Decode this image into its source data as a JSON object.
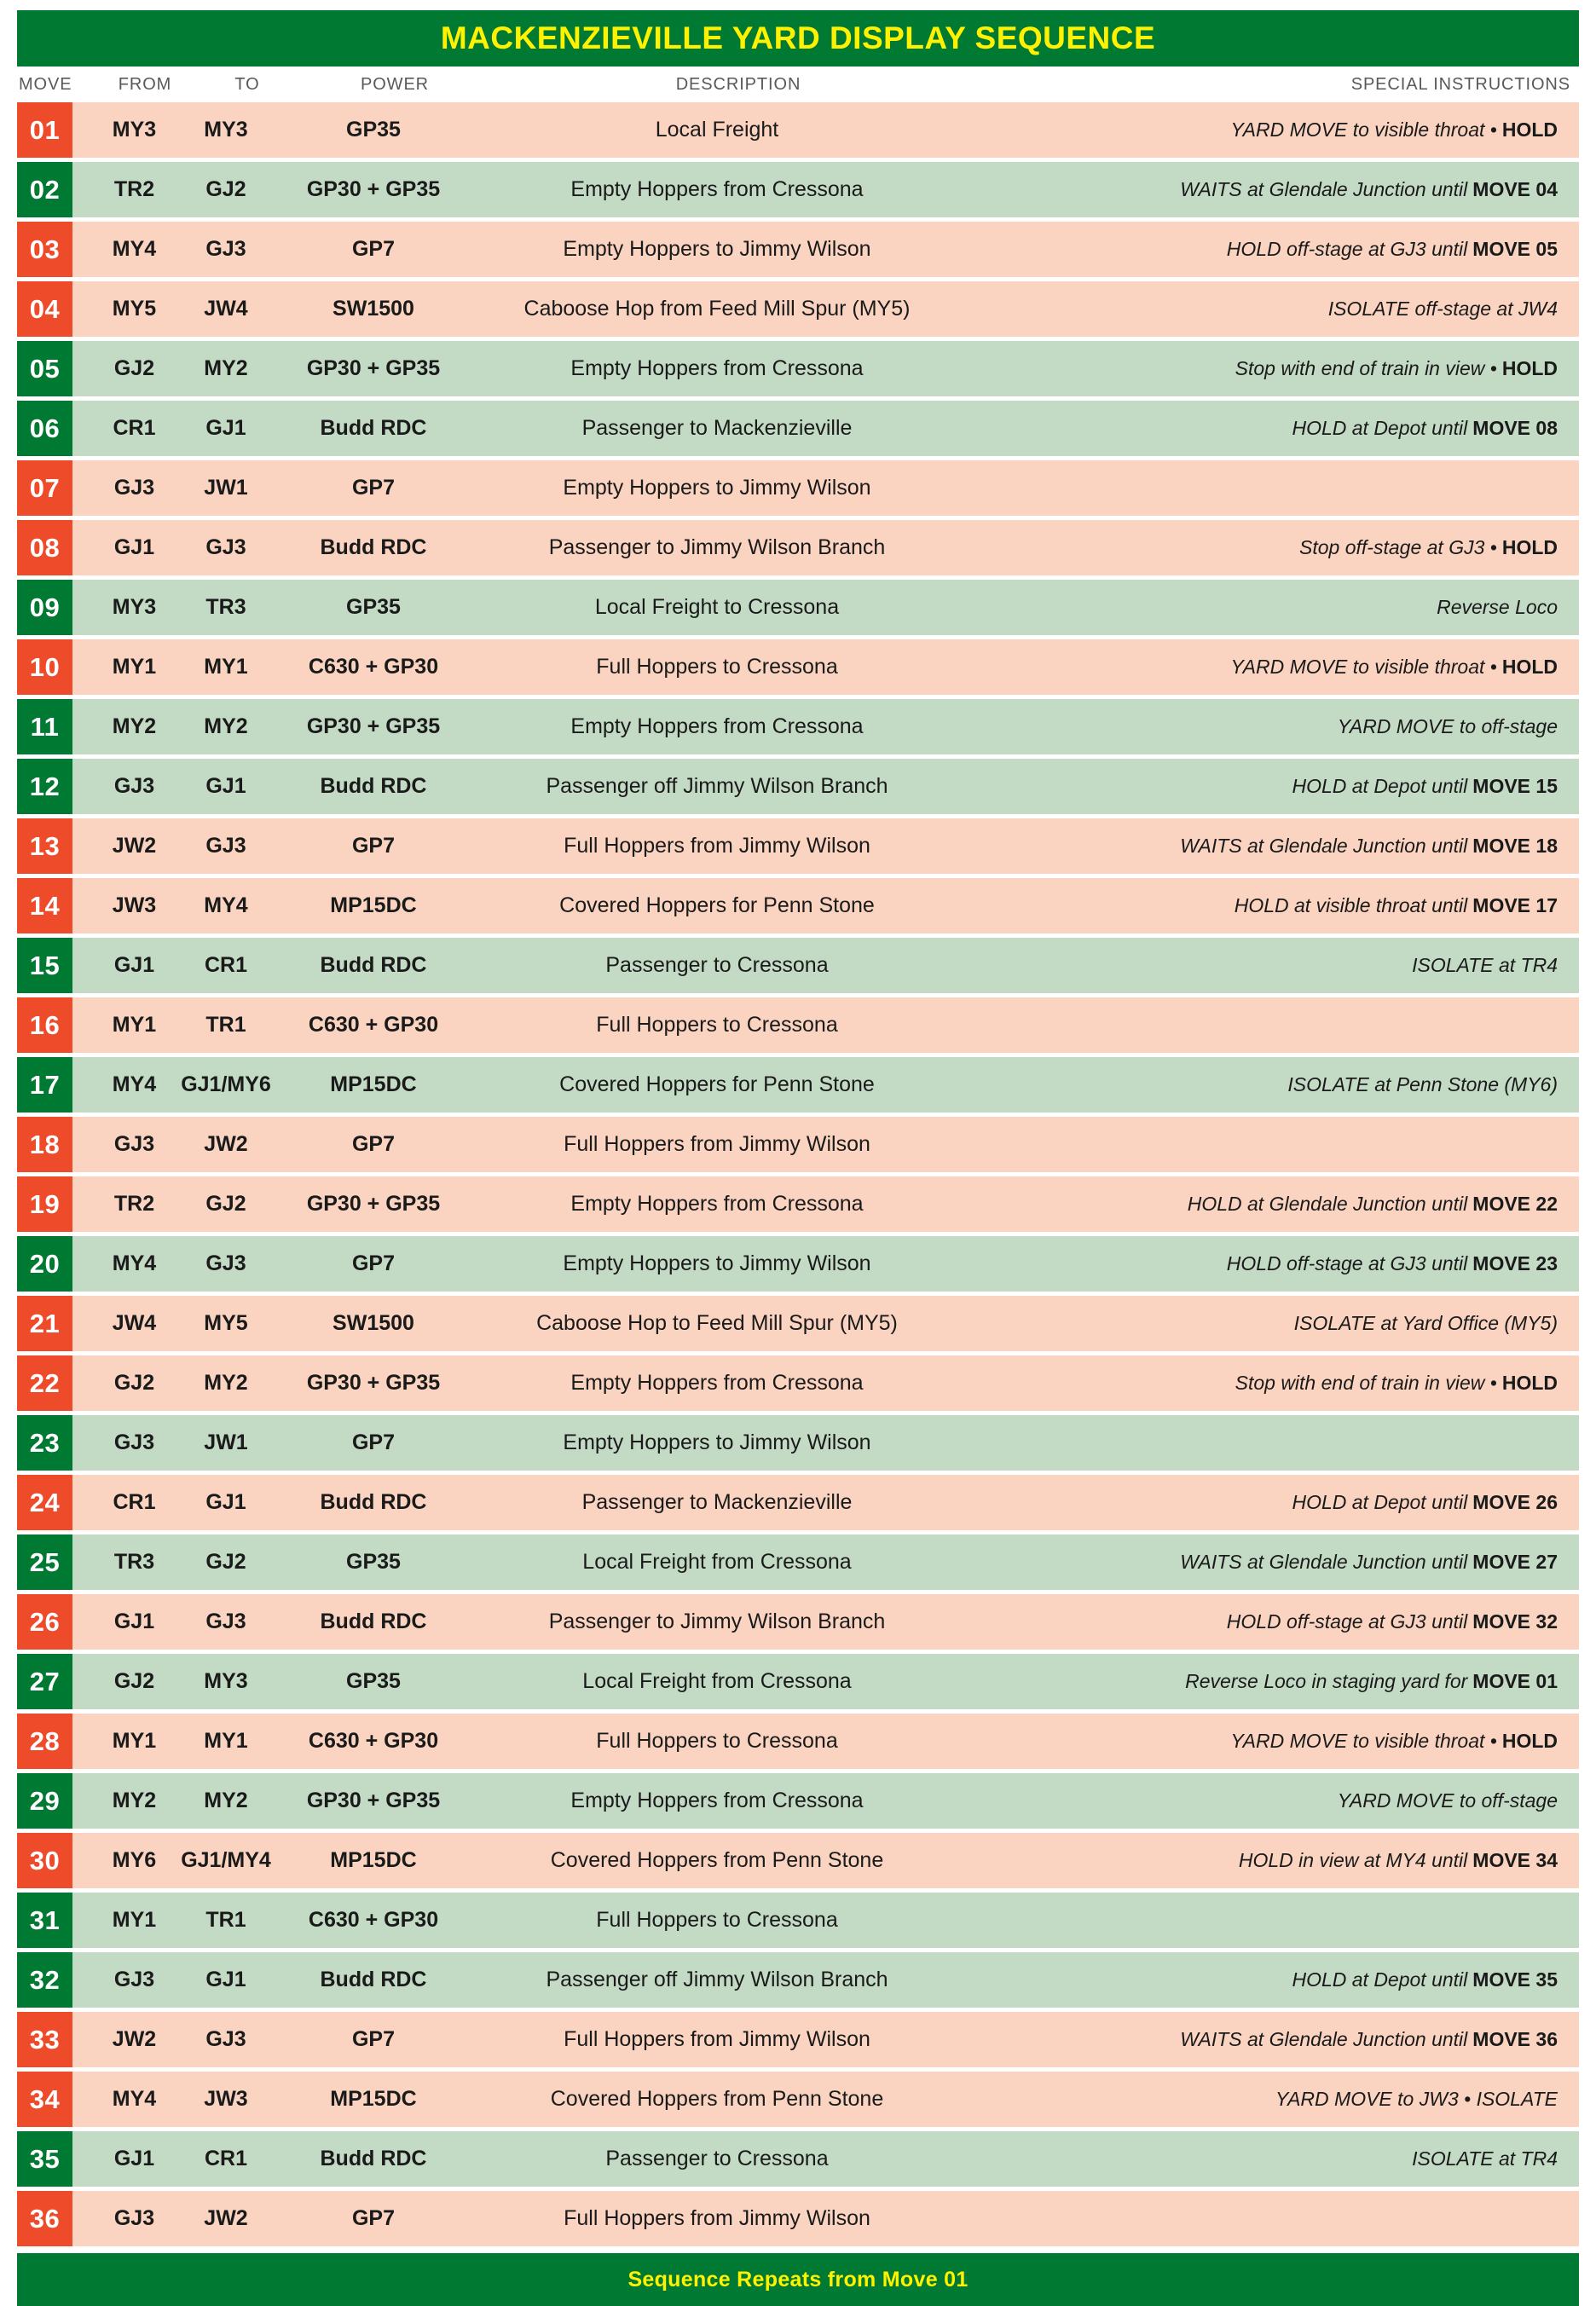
{
  "title": "MACKENZIEVILLE YARD DISPLAY SEQUENCE",
  "colors": {
    "header_green": "#007A33",
    "header_yellow": "#FFF200",
    "badge_red": "#EE4B2B",
    "badge_green": "#007A33",
    "row_pink": "#FAD4C0",
    "row_green": "#C3DBC5"
  },
  "columns": {
    "move": "MOVE",
    "from": "FROM",
    "to": "TO",
    "power": "POWER",
    "description": "DESCRIPTION",
    "instructions": "SPECIAL INSTRUCTIONS"
  },
  "footer": "Sequence Repeats from Move 01",
  "rows": [
    {
      "move": "01",
      "from": "MY3",
      "to": "MY3",
      "power": "GP35",
      "desc": "Local Freight",
      "inst": "YARD MOVE to visible throat • ",
      "inst_bold": "HOLD",
      "badge": "red",
      "bg": "pink"
    },
    {
      "move": "02",
      "from": "TR2",
      "to": "GJ2",
      "power": "GP30 + GP35",
      "desc": "Empty Hoppers from Cressona",
      "inst": "WAITS at Glendale Junction until ",
      "inst_bold": "MOVE 04",
      "badge": "green",
      "bg": "green"
    },
    {
      "move": "03",
      "from": "MY4",
      "to": "GJ3",
      "power": "GP7",
      "desc": "Empty Hoppers to Jimmy Wilson",
      "inst": "HOLD off-stage at GJ3 until ",
      "inst_bold": "MOVE 05",
      "badge": "red",
      "bg": "pink"
    },
    {
      "move": "04",
      "from": "MY5",
      "to": "JW4",
      "power": "SW1500",
      "desc": "Caboose Hop from Feed Mill Spur (MY5)",
      "inst": "ISOLATE off-stage at JW4",
      "inst_bold": "",
      "badge": "red",
      "bg": "pink"
    },
    {
      "move": "05",
      "from": "GJ2",
      "to": "MY2",
      "power": "GP30 + GP35",
      "desc": "Empty Hoppers from Cressona",
      "inst": "Stop with end of train in view • ",
      "inst_bold": "HOLD",
      "badge": "green",
      "bg": "green"
    },
    {
      "move": "06",
      "from": "CR1",
      "to": "GJ1",
      "power": "Budd RDC",
      "desc": "Passenger to Mackenzieville",
      "inst": "HOLD at Depot until ",
      "inst_bold": "MOVE 08",
      "badge": "green",
      "bg": "green"
    },
    {
      "move": "07",
      "from": "GJ3",
      "to": "JW1",
      "power": "GP7",
      "desc": "Empty Hoppers to Jimmy Wilson",
      "inst": "",
      "inst_bold": "",
      "badge": "red",
      "bg": "pink"
    },
    {
      "move": "08",
      "from": "GJ1",
      "to": "GJ3",
      "power": "Budd RDC",
      "desc": "Passenger to Jimmy Wilson Branch",
      "inst": "Stop off-stage at GJ3 • ",
      "inst_bold": "HOLD",
      "badge": "red",
      "bg": "pink"
    },
    {
      "move": "09",
      "from": "MY3",
      "to": "TR3",
      "power": "GP35",
      "desc": "Local Freight to Cressona",
      "inst": "Reverse Loco",
      "inst_bold": "",
      "badge": "green",
      "bg": "green"
    },
    {
      "move": "10",
      "from": "MY1",
      "to": "MY1",
      "power": "C630 + GP30",
      "desc": "Full Hoppers to Cressona",
      "inst": "YARD MOVE to visible throat • ",
      "inst_bold": "HOLD",
      "badge": "red",
      "bg": "pink"
    },
    {
      "move": "11",
      "from": "MY2",
      "to": "MY2",
      "power": "GP30 + GP35",
      "desc": "Empty Hoppers from Cressona",
      "inst": "YARD MOVE to off-stage",
      "inst_bold": "",
      "badge": "green",
      "bg": "green"
    },
    {
      "move": "12",
      "from": "GJ3",
      "to": "GJ1",
      "power": "Budd RDC",
      "desc": "Passenger off Jimmy Wilson Branch",
      "inst": "HOLD at Depot until ",
      "inst_bold": "MOVE 15",
      "badge": "green",
      "bg": "green"
    },
    {
      "move": "13",
      "from": "JW2",
      "to": "GJ3",
      "power": "GP7",
      "desc": "Full Hoppers from Jimmy Wilson",
      "inst": "WAITS at Glendale Junction until ",
      "inst_bold": "MOVE 18",
      "badge": "red",
      "bg": "pink"
    },
    {
      "move": "14",
      "from": "JW3",
      "to": "MY4",
      "power": "MP15DC",
      "desc": "Covered Hoppers for Penn Stone",
      "inst": "HOLD at visible throat until ",
      "inst_bold": "MOVE 17",
      "badge": "red",
      "bg": "pink"
    },
    {
      "move": "15",
      "from": "GJ1",
      "to": "CR1",
      "power": "Budd RDC",
      "desc": "Passenger to Cressona",
      "inst": "ISOLATE at TR4",
      "inst_bold": "",
      "badge": "green",
      "bg": "green"
    },
    {
      "move": "16",
      "from": "MY1",
      "to": "TR1",
      "power": "C630 + GP30",
      "desc": "Full Hoppers to Cressona",
      "inst": "",
      "inst_bold": "",
      "badge": "red",
      "bg": "pink"
    },
    {
      "move": "17",
      "from": "MY4",
      "to": "GJ1/MY6",
      "power": "MP15DC",
      "desc": "Covered Hoppers for Penn Stone",
      "inst": "ISOLATE at Penn Stone (MY6)",
      "inst_bold": "",
      "badge": "green",
      "bg": "green"
    },
    {
      "move": "18",
      "from": "GJ3",
      "to": "JW2",
      "power": "GP7",
      "desc": "Full Hoppers from Jimmy Wilson",
      "inst": "",
      "inst_bold": "",
      "badge": "red",
      "bg": "pink"
    },
    {
      "move": "19",
      "from": "TR2",
      "to": "GJ2",
      "power": "GP30 + GP35",
      "desc": "Empty Hoppers from Cressona",
      "inst": "HOLD at Glendale Junction until ",
      "inst_bold": "MOVE 22",
      "badge": "red",
      "bg": "pink"
    },
    {
      "move": "20",
      "from": "MY4",
      "to": "GJ3",
      "power": "GP7",
      "desc": "Empty Hoppers to Jimmy Wilson",
      "inst": "HOLD off-stage at GJ3 until ",
      "inst_bold": "MOVE 23",
      "badge": "green",
      "bg": "green"
    },
    {
      "move": "21",
      "from": "JW4",
      "to": "MY5",
      "power": "SW1500",
      "desc": "Caboose Hop to Feed Mill Spur (MY5)",
      "inst": "ISOLATE at Yard Office (MY5)",
      "inst_bold": "",
      "badge": "red",
      "bg": "pink"
    },
    {
      "move": "22",
      "from": "GJ2",
      "to": "MY2",
      "power": "GP30 + GP35",
      "desc": "Empty Hoppers from Cressona",
      "inst": "Stop with end of train in view • ",
      "inst_bold": "HOLD",
      "badge": "red",
      "bg": "pink"
    },
    {
      "move": "23",
      "from": "GJ3",
      "to": "JW1",
      "power": "GP7",
      "desc": "Empty Hoppers to Jimmy Wilson",
      "inst": "",
      "inst_bold": "",
      "badge": "green",
      "bg": "green"
    },
    {
      "move": "24",
      "from": "CR1",
      "to": "GJ1",
      "power": "Budd RDC",
      "desc": "Passenger to Mackenzieville",
      "inst": "HOLD at Depot until ",
      "inst_bold": "MOVE 26",
      "badge": "red",
      "bg": "pink"
    },
    {
      "move": "25",
      "from": "TR3",
      "to": "GJ2",
      "power": "GP35",
      "desc": "Local Freight from Cressona",
      "inst": "WAITS at Glendale Junction until ",
      "inst_bold": "MOVE 27",
      "badge": "green",
      "bg": "green"
    },
    {
      "move": "26",
      "from": "GJ1",
      "to": "GJ3",
      "power": "Budd RDC",
      "desc": "Passenger to Jimmy Wilson Branch",
      "inst": "HOLD off-stage at GJ3 until ",
      "inst_bold": "MOVE 32",
      "badge": "red",
      "bg": "pink"
    },
    {
      "move": "27",
      "from": "GJ2",
      "to": "MY3",
      "power": "GP35",
      "desc": "Local Freight from Cressona",
      "inst": "Reverse Loco in staging yard for ",
      "inst_bold": "MOVE 01",
      "badge": "green",
      "bg": "green"
    },
    {
      "move": "28",
      "from": "MY1",
      "to": "MY1",
      "power": "C630 + GP30",
      "desc": "Full Hoppers to Cressona",
      "inst": "YARD MOVE to visible throat • ",
      "inst_bold": "HOLD",
      "badge": "red",
      "bg": "pink"
    },
    {
      "move": "29",
      "from": "MY2",
      "to": "MY2",
      "power": "GP30 + GP35",
      "desc": "Empty Hoppers from Cressona",
      "inst": "YARD MOVE to off-stage",
      "inst_bold": "",
      "badge": "green",
      "bg": "green"
    },
    {
      "move": "30",
      "from": "MY6",
      "to": "GJ1/MY4",
      "power": "MP15DC",
      "desc": "Covered Hoppers from Penn Stone",
      "inst": "HOLD in view at MY4 until ",
      "inst_bold": "MOVE 34",
      "badge": "red",
      "bg": "pink"
    },
    {
      "move": "31",
      "from": "MY1",
      "to": "TR1",
      "power": "C630 + GP30",
      "desc": "Full Hoppers to Cressona",
      "inst": "",
      "inst_bold": "",
      "badge": "green",
      "bg": "green"
    },
    {
      "move": "32",
      "from": "GJ3",
      "to": "GJ1",
      "power": "Budd RDC",
      "desc": "Passenger off Jimmy Wilson Branch",
      "inst": "HOLD at Depot until ",
      "inst_bold": "MOVE 35",
      "badge": "green",
      "bg": "green"
    },
    {
      "move": "33",
      "from": "JW2",
      "to": "GJ3",
      "power": "GP7",
      "desc": "Full Hoppers from Jimmy Wilson",
      "inst": "WAITS at Glendale Junction until ",
      "inst_bold": "MOVE 36",
      "badge": "red",
      "bg": "pink"
    },
    {
      "move": "34",
      "from": "MY4",
      "to": "JW3",
      "power": "MP15DC",
      "desc": "Covered Hoppers from Penn Stone",
      "inst": "YARD MOVE to JW3 • ISOLATE",
      "inst_bold": "",
      "badge": "red",
      "bg": "pink"
    },
    {
      "move": "35",
      "from": "GJ1",
      "to": "CR1",
      "power": "Budd RDC",
      "desc": "Passenger to Cressona",
      "inst": "ISOLATE at TR4",
      "inst_bold": "",
      "badge": "green",
      "bg": "green"
    },
    {
      "move": "36",
      "from": "GJ3",
      "to": "JW2",
      "power": "GP7",
      "desc": "Full Hoppers from Jimmy Wilson",
      "inst": "",
      "inst_bold": "",
      "badge": "red",
      "bg": "pink"
    }
  ]
}
